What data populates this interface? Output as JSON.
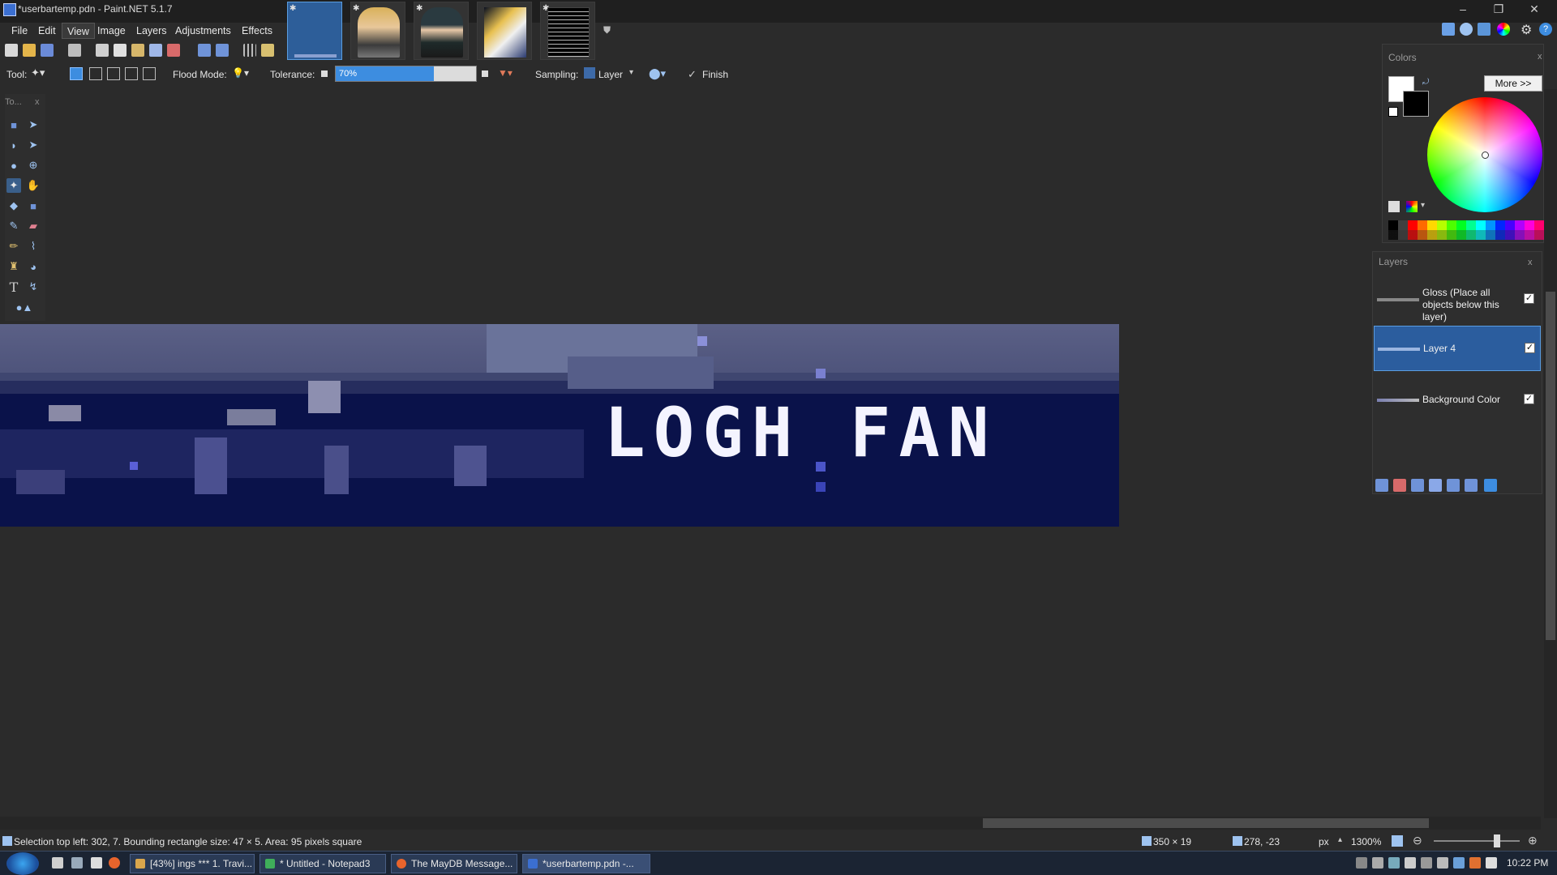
{
  "window": {
    "title": "*userbartemp.pdn - Paint.NET 5.1.7",
    "minimize": "–",
    "restore": "❐",
    "close": "✕"
  },
  "menu": {
    "items": [
      "File",
      "Edit",
      "View",
      "Image",
      "Layers",
      "Adjustments",
      "Effects"
    ],
    "active": "View"
  },
  "toolbar2": {
    "tool_label": "Tool:",
    "flood_mode_label": "Flood Mode:",
    "tolerance_label": "Tolerance:",
    "tolerance_value": "70%",
    "tolerance_fraction": 0.7,
    "sampling_label": "Sampling:",
    "sampling_value": "Layer",
    "finish_label": "Finish"
  },
  "tools_panel": {
    "title": "To...",
    "close": "x"
  },
  "canvas": {
    "text": "LOGH FAN"
  },
  "colors_panel": {
    "title": "Colors",
    "close": "x",
    "more_button": "More >>",
    "primary_color": "#ffffff",
    "secondary_color": "#000000",
    "palette": [
      "#000000",
      "#404040",
      "#ff0000",
      "#ff6a00",
      "#ffd800",
      "#b6ff00",
      "#4cff00",
      "#00ff21",
      "#00ff90",
      "#00ffff",
      "#0094ff",
      "#0026ff",
      "#4800ff",
      "#b200ff",
      "#ff00dc",
      "#ff006e"
    ]
  },
  "layers_panel": {
    "title": "Layers",
    "close": "x",
    "layers": [
      {
        "name": "Gloss (Place all objects below this layer)",
        "visible": true,
        "selected": false
      },
      {
        "name": "Layer 4",
        "visible": true,
        "selected": true
      },
      {
        "name": "Background Color",
        "visible": true,
        "selected": false
      }
    ]
  },
  "status": {
    "selection_info": "Selection top left: 302, 7. Bounding rectangle size: 47 × 5. Area: 95 pixels square",
    "image_size": "350 × 19",
    "cursor_position": "278, -23",
    "unit": "px",
    "zoom": "1300%"
  },
  "taskbar": {
    "items": [
      {
        "label": "[43%] ings *** 1. Travi...",
        "color": "#d9a64c"
      },
      {
        "label": "* Untitled - Notepad3",
        "color": "#3fae5a"
      },
      {
        "label": "The MayDB Message...",
        "color": "#e8642c"
      },
      {
        "label": "*userbartemp.pdn -...",
        "color": "#3b6fd1"
      }
    ],
    "clock": "10:22 PM"
  }
}
